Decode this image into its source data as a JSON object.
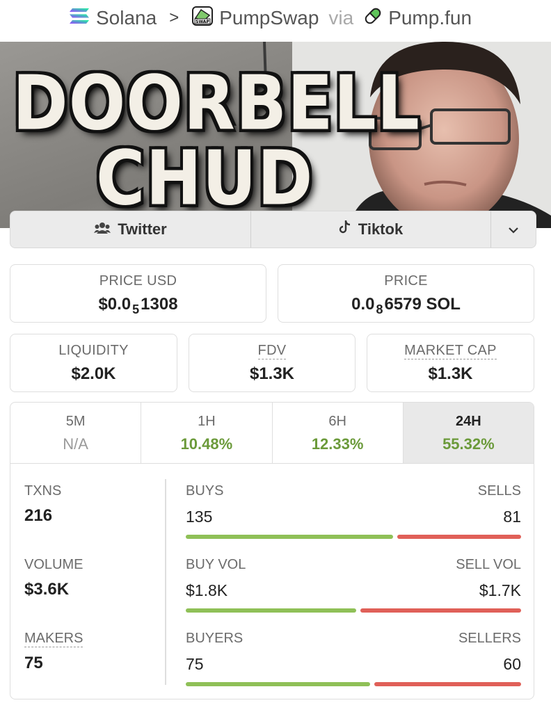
{
  "breadcrumb": {
    "chain": "Solana",
    "dex": "PumpSwap",
    "via": "via",
    "launchpad": "Pump.fun"
  },
  "banner": {
    "line1": "DOORBELL",
    "line2": "CHUD"
  },
  "social": {
    "twitter": "Twitter",
    "tiktok": "Tiktok"
  },
  "prices": {
    "price_usd_label": "PRICE USD",
    "price_usd": {
      "prefix": "$0.0",
      "zeros": "5",
      "digits": "1308"
    },
    "price_label": "PRICE",
    "price_native": {
      "prefix": "0.0",
      "zeros": "8",
      "digits": "6579 SOL"
    }
  },
  "stats": {
    "liquidity_label": "LIQUIDITY",
    "liquidity": "$2.0K",
    "fdv_label": "FDV",
    "fdv": "$1.3K",
    "mcap_label": "MARKET CAP",
    "mcap": "$1.3K"
  },
  "timeframes": [
    {
      "label": "5M",
      "value": "N/A"
    },
    {
      "label": "1H",
      "value": "10.48%"
    },
    {
      "label": "6H",
      "value": "12.33%"
    },
    {
      "label": "24H",
      "value": "55.32%"
    }
  ],
  "metrics": {
    "txns_label": "TXNS",
    "txns": "216",
    "volume_label": "VOLUME",
    "volume": "$3.6K",
    "makers_label": "MAKERS",
    "makers": "75",
    "buys_label": "BUYS",
    "buys": "135",
    "sells_label": "SELLS",
    "sells": "81",
    "buy_vol_label": "BUY VOL",
    "buy_vol": "$1.8K",
    "sell_vol_label": "SELL VOL",
    "sell_vol": "$1.7K",
    "buyers_label": "BUYERS",
    "buyers": "75",
    "sellers_label": "SELLERS",
    "sellers": "60",
    "buys_share": 0.625,
    "buy_vol_share": 0.514,
    "buyers_share": 0.556
  },
  "colors": {
    "positive": "#6b9a3a",
    "buy_bar": "#8fc057",
    "sell_bar": "#e06058"
  }
}
